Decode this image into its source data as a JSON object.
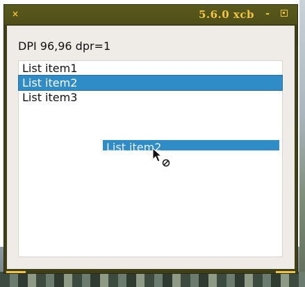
{
  "window": {
    "title": "5.6.0 xcb",
    "close_glyph": "×",
    "minimize_glyph": "-"
  },
  "content": {
    "dpi_text": "DPI 96,96 dpr=1",
    "list_items": [
      {
        "label": "List item1",
        "selected": false
      },
      {
        "label": "List item2",
        "selected": true
      },
      {
        "label": "List item3",
        "selected": false
      }
    ],
    "drag_preview_label": "List item2"
  },
  "colors": {
    "title_bar": "#4e4f17",
    "title_text": "#f2c440",
    "selection": "#308cc6",
    "client_bg": "#efebe7"
  },
  "icons": {
    "cursor": "arrow-no-drop-cursor-icon"
  }
}
